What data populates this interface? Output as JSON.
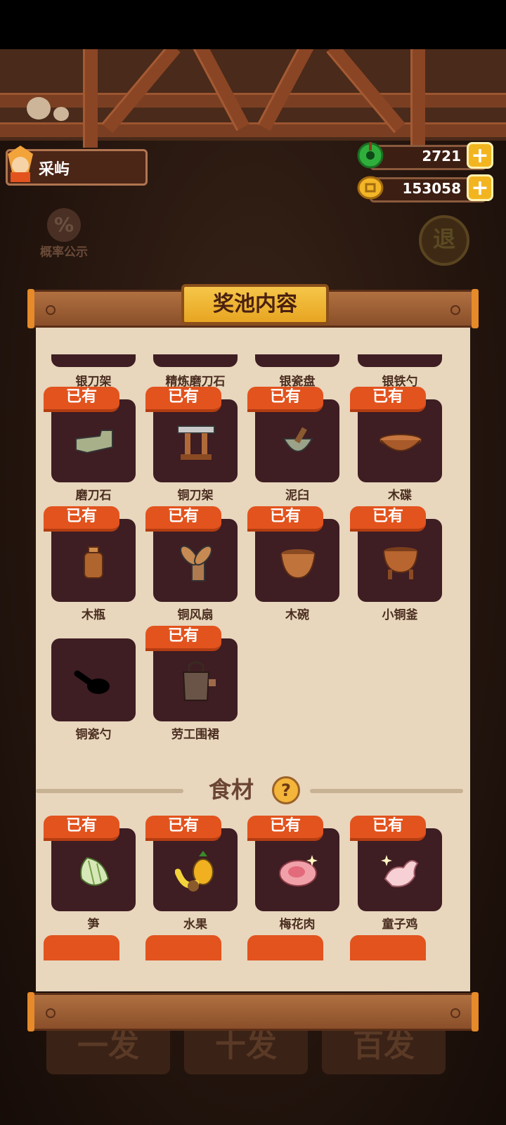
{
  "header": {
    "player_name": "采屿",
    "jade": "2721",
    "coins": "153058",
    "rates_label": "概率公示",
    "rates_symbol": "%",
    "exit_label": "退"
  },
  "panel": {
    "title": "奖池内容",
    "owned_label": "已有",
    "top_partial": [
      "银刀架",
      "精炼磨刀石",
      "银瓷盘",
      "银铁勺"
    ],
    "items": [
      {
        "name": "磨刀石",
        "owned": true,
        "icon": "whetstone-icon"
      },
      {
        "name": "铜刀架",
        "owned": true,
        "icon": "knife-rack-icon"
      },
      {
        "name": "泥臼",
        "owned": true,
        "icon": "mortar-icon"
      },
      {
        "name": "木碟",
        "owned": true,
        "icon": "wooden-dish-icon"
      },
      {
        "name": "木瓶",
        "owned": true,
        "icon": "wooden-bottle-icon"
      },
      {
        "name": "铜风扇",
        "owned": true,
        "icon": "fan-icon"
      },
      {
        "name": "木碗",
        "owned": true,
        "icon": "wooden-bowl-icon"
      },
      {
        "name": "小铜釜",
        "owned": true,
        "icon": "cauldron-icon"
      },
      {
        "name": "铜瓷勺",
        "owned": false,
        "icon": "spoon-silhouette-icon"
      },
      {
        "name": "劳工围裙",
        "owned": true,
        "icon": "apron-icon"
      }
    ],
    "section_title": "食材",
    "help_symbol": "?",
    "ingredients": [
      {
        "name": "笋",
        "owned": true,
        "icon": "bamboo-shoot-icon"
      },
      {
        "name": "水果",
        "owned": true,
        "icon": "fruit-icon"
      },
      {
        "name": "梅花肉",
        "owned": true,
        "icon": "pork-icon"
      },
      {
        "name": "童子鸡",
        "owned": true,
        "icon": "chicken-icon"
      }
    ]
  },
  "bottom_buttons": [
    "一发",
    "十发",
    "百发"
  ],
  "colors": {
    "badge": "#e2531e",
    "paper": "#e8d6bd",
    "slot": "#3e1d23",
    "plate": "#f2b627"
  }
}
